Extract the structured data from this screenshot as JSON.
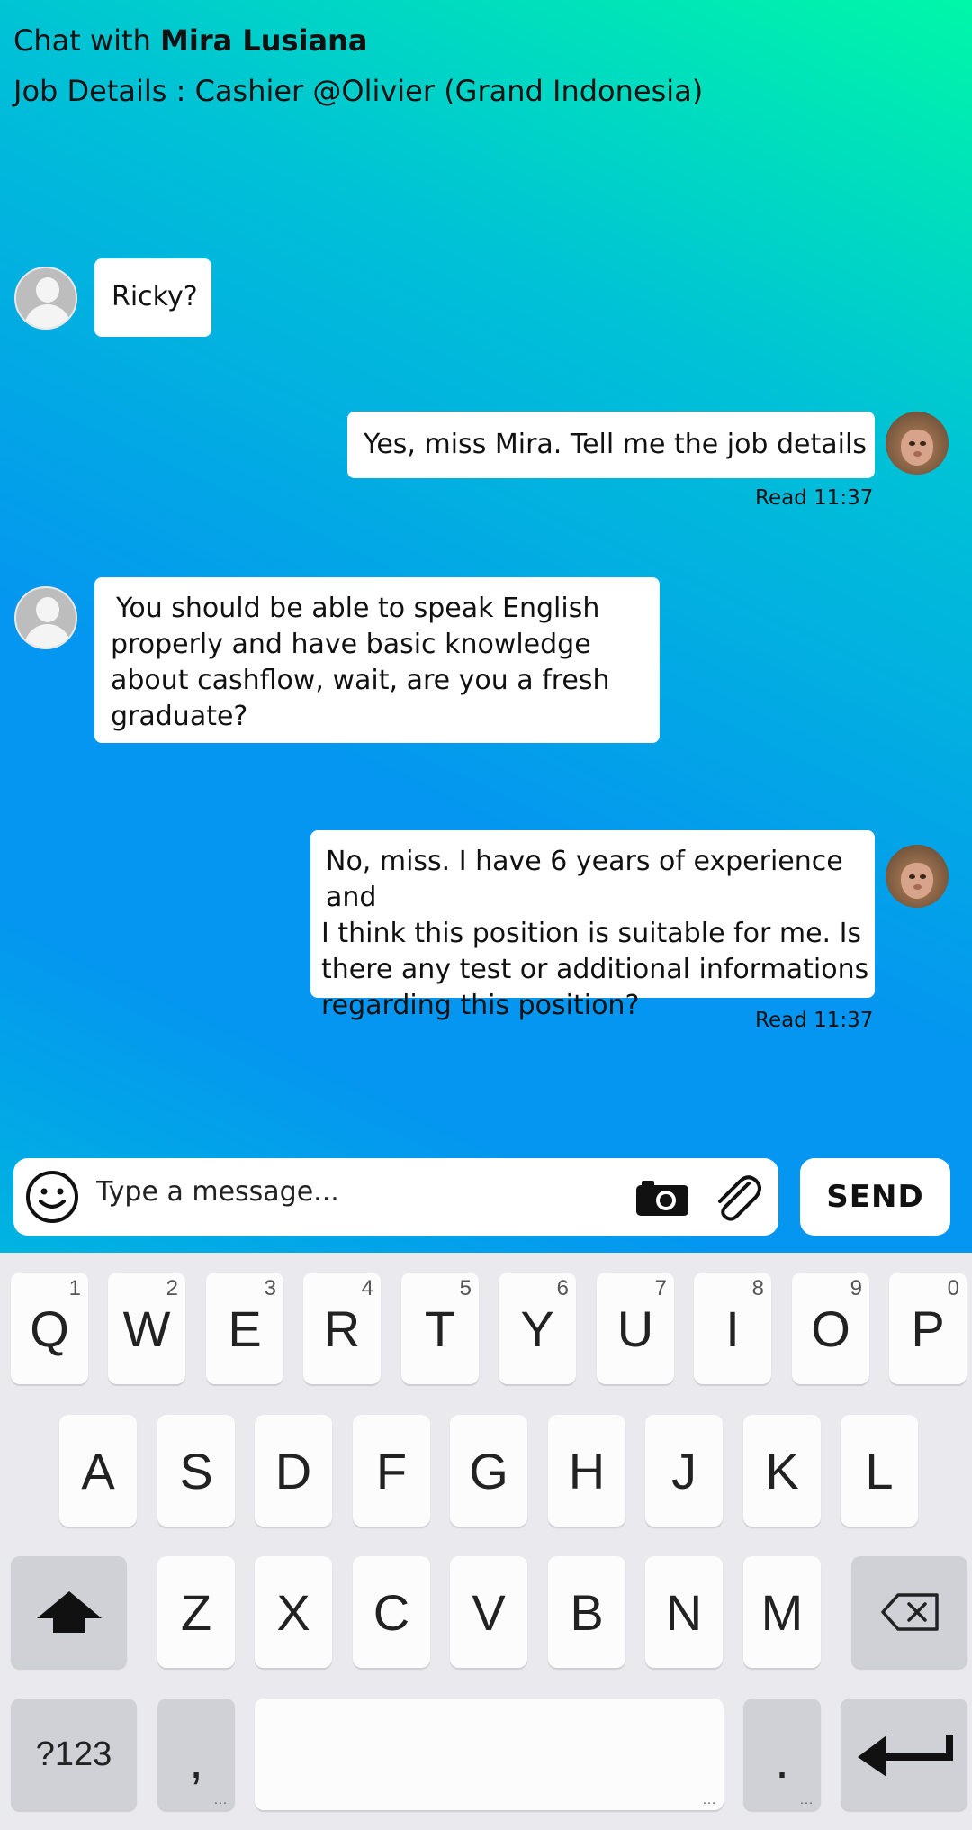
{
  "header": {
    "title_prefix": "Chat with",
    "contact_name": "Mira Lusiana",
    "job_details": "Job Details : Cashier @Olivier (Grand Indonesia)"
  },
  "messages": [
    {
      "sender": "contact",
      "text": "Ricky?"
    },
    {
      "sender": "me",
      "text": "Yes, miss Mira. Tell me the job details",
      "status": "Read 11:37"
    },
    {
      "sender": "contact",
      "lines": [
        "You should be able to speak English",
        "properly and have basic knowledge",
        "about cashflow, wait, are you a fresh",
        "graduate?"
      ]
    },
    {
      "sender": "me",
      "lines": [
        "No, miss. I have 6 years of experience and",
        "I think this position is suitable for me. Is",
        "there any test or additional informations",
        "regarding this position?"
      ],
      "status": "Read 11:37"
    }
  ],
  "composer": {
    "placeholder": "Type a message...",
    "send_label": "SEND"
  },
  "keyboard": {
    "row1": [
      [
        "Q",
        "1"
      ],
      [
        "W",
        "2"
      ],
      [
        "E",
        "3"
      ],
      [
        "R",
        "4"
      ],
      [
        "T",
        "5"
      ],
      [
        "Y",
        "6"
      ],
      [
        "U",
        "7"
      ],
      [
        "I",
        "8"
      ],
      [
        "O",
        "9"
      ],
      [
        "P",
        "0"
      ]
    ],
    "row2": [
      "A",
      "S",
      "D",
      "F",
      "G",
      "H",
      "J",
      "K",
      "L"
    ],
    "row3": [
      "Z",
      "X",
      "C",
      "V",
      "B",
      "N",
      "M"
    ],
    "symbols_label": "?123",
    "comma": ",",
    "period": "."
  }
}
